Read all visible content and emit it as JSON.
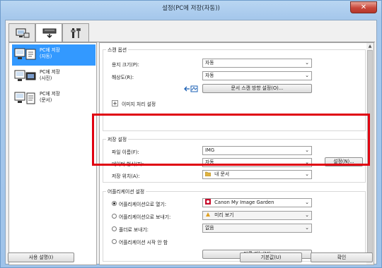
{
  "window": {
    "title": "설정(PC에 저장(자동))",
    "close": "✕"
  },
  "tabs": [
    {
      "name": "scan-from-computer",
      "icon": "computer-scan-icon",
      "active": false
    },
    {
      "name": "scan-from-panel",
      "icon": "scanner-panel-icon",
      "active": true
    },
    {
      "name": "general-settings",
      "icon": "tools-icon",
      "active": false
    }
  ],
  "sidebar": {
    "items": [
      {
        "label": "PC에 저장\n(자동)",
        "selected": true,
        "icon": "save-auto-icon"
      },
      {
        "label": "PC에 저장\n(사진)",
        "selected": false,
        "icon": "save-photo-icon"
      },
      {
        "label": "PC에 저장\n(문서)",
        "selected": false,
        "icon": "save-document-icon"
      }
    ]
  },
  "scan_options": {
    "title": "스캔 옵션",
    "paper_size_label": "용지 크기(P):",
    "paper_size_value": "자동",
    "resolution_label": "해상도(R):",
    "resolution_value": "자동",
    "orientation_button": "문서 스캔 방향 설정(O)...",
    "image_processing_label": "이미지 처리 설정",
    "orientation_icon": "orientation-icon"
  },
  "save_settings": {
    "title": "저장 설정",
    "file_name_label": "파일 이름(F):",
    "file_name_value": "IMG",
    "data_format_label": "데이터 형식(T):",
    "data_format_value": "자동",
    "settings_button": "설정(N)...",
    "save_in_label": "저장 위치(A):",
    "save_in_value": "내 문서",
    "folder_icon": "folder-icon"
  },
  "app_settings": {
    "title": "어플리케이션 설정",
    "options": [
      {
        "label": "어플리케이션으로 열기:",
        "selected": true,
        "value": "Canon My Image Garden",
        "icon": "canon-app-icon"
      },
      {
        "label": "어플리케이션으로 보내기:",
        "selected": false,
        "value": "미리 보기",
        "icon": "preview-app-icon"
      },
      {
        "label": "폴더로 보내기:",
        "selected": false,
        "value": "없음"
      },
      {
        "label": "어플리케이션 시작 안 함",
        "selected": false
      }
    ],
    "more_functions_button": "다른 기능(M)"
  },
  "footer": {
    "instructions_button": "사용 설명(I)",
    "defaults_button": "기본값(U)",
    "ok_button": "확인"
  },
  "colors": {
    "highlight": "#e00010",
    "selection": "#3399ff"
  }
}
